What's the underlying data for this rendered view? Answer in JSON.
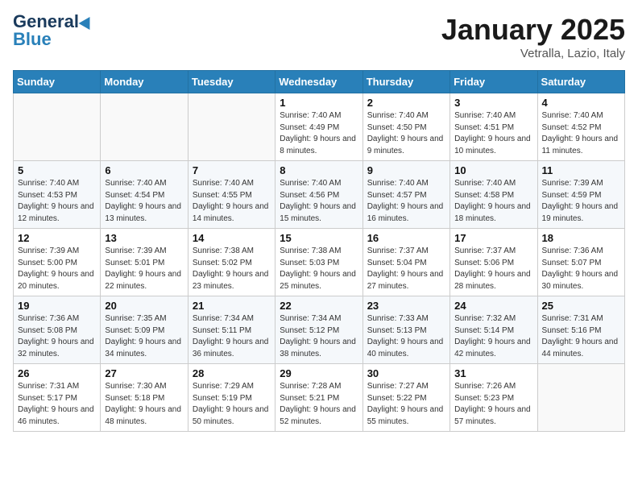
{
  "header": {
    "logo_line1": "General",
    "logo_line2": "Blue",
    "month": "January 2025",
    "location": "Vetralla, Lazio, Italy"
  },
  "days_of_week": [
    "Sunday",
    "Monday",
    "Tuesday",
    "Wednesday",
    "Thursday",
    "Friday",
    "Saturday"
  ],
  "weeks": [
    [
      {
        "day": "",
        "info": ""
      },
      {
        "day": "",
        "info": ""
      },
      {
        "day": "",
        "info": ""
      },
      {
        "day": "1",
        "info": "Sunrise: 7:40 AM\nSunset: 4:49 PM\nDaylight: 9 hours and 8 minutes."
      },
      {
        "day": "2",
        "info": "Sunrise: 7:40 AM\nSunset: 4:50 PM\nDaylight: 9 hours and 9 minutes."
      },
      {
        "day": "3",
        "info": "Sunrise: 7:40 AM\nSunset: 4:51 PM\nDaylight: 9 hours and 10 minutes."
      },
      {
        "day": "4",
        "info": "Sunrise: 7:40 AM\nSunset: 4:52 PM\nDaylight: 9 hours and 11 minutes."
      }
    ],
    [
      {
        "day": "5",
        "info": "Sunrise: 7:40 AM\nSunset: 4:53 PM\nDaylight: 9 hours and 12 minutes."
      },
      {
        "day": "6",
        "info": "Sunrise: 7:40 AM\nSunset: 4:54 PM\nDaylight: 9 hours and 13 minutes."
      },
      {
        "day": "7",
        "info": "Sunrise: 7:40 AM\nSunset: 4:55 PM\nDaylight: 9 hours and 14 minutes."
      },
      {
        "day": "8",
        "info": "Sunrise: 7:40 AM\nSunset: 4:56 PM\nDaylight: 9 hours and 15 minutes."
      },
      {
        "day": "9",
        "info": "Sunrise: 7:40 AM\nSunset: 4:57 PM\nDaylight: 9 hours and 16 minutes."
      },
      {
        "day": "10",
        "info": "Sunrise: 7:40 AM\nSunset: 4:58 PM\nDaylight: 9 hours and 18 minutes."
      },
      {
        "day": "11",
        "info": "Sunrise: 7:39 AM\nSunset: 4:59 PM\nDaylight: 9 hours and 19 minutes."
      }
    ],
    [
      {
        "day": "12",
        "info": "Sunrise: 7:39 AM\nSunset: 5:00 PM\nDaylight: 9 hours and 20 minutes."
      },
      {
        "day": "13",
        "info": "Sunrise: 7:39 AM\nSunset: 5:01 PM\nDaylight: 9 hours and 22 minutes."
      },
      {
        "day": "14",
        "info": "Sunrise: 7:38 AM\nSunset: 5:02 PM\nDaylight: 9 hours and 23 minutes."
      },
      {
        "day": "15",
        "info": "Sunrise: 7:38 AM\nSunset: 5:03 PM\nDaylight: 9 hours and 25 minutes."
      },
      {
        "day": "16",
        "info": "Sunrise: 7:37 AM\nSunset: 5:04 PM\nDaylight: 9 hours and 27 minutes."
      },
      {
        "day": "17",
        "info": "Sunrise: 7:37 AM\nSunset: 5:06 PM\nDaylight: 9 hours and 28 minutes."
      },
      {
        "day": "18",
        "info": "Sunrise: 7:36 AM\nSunset: 5:07 PM\nDaylight: 9 hours and 30 minutes."
      }
    ],
    [
      {
        "day": "19",
        "info": "Sunrise: 7:36 AM\nSunset: 5:08 PM\nDaylight: 9 hours and 32 minutes."
      },
      {
        "day": "20",
        "info": "Sunrise: 7:35 AM\nSunset: 5:09 PM\nDaylight: 9 hours and 34 minutes."
      },
      {
        "day": "21",
        "info": "Sunrise: 7:34 AM\nSunset: 5:11 PM\nDaylight: 9 hours and 36 minutes."
      },
      {
        "day": "22",
        "info": "Sunrise: 7:34 AM\nSunset: 5:12 PM\nDaylight: 9 hours and 38 minutes."
      },
      {
        "day": "23",
        "info": "Sunrise: 7:33 AM\nSunset: 5:13 PM\nDaylight: 9 hours and 40 minutes."
      },
      {
        "day": "24",
        "info": "Sunrise: 7:32 AM\nSunset: 5:14 PM\nDaylight: 9 hours and 42 minutes."
      },
      {
        "day": "25",
        "info": "Sunrise: 7:31 AM\nSunset: 5:16 PM\nDaylight: 9 hours and 44 minutes."
      }
    ],
    [
      {
        "day": "26",
        "info": "Sunrise: 7:31 AM\nSunset: 5:17 PM\nDaylight: 9 hours and 46 minutes."
      },
      {
        "day": "27",
        "info": "Sunrise: 7:30 AM\nSunset: 5:18 PM\nDaylight: 9 hours and 48 minutes."
      },
      {
        "day": "28",
        "info": "Sunrise: 7:29 AM\nSunset: 5:19 PM\nDaylight: 9 hours and 50 minutes."
      },
      {
        "day": "29",
        "info": "Sunrise: 7:28 AM\nSunset: 5:21 PM\nDaylight: 9 hours and 52 minutes."
      },
      {
        "day": "30",
        "info": "Sunrise: 7:27 AM\nSunset: 5:22 PM\nDaylight: 9 hours and 55 minutes."
      },
      {
        "day": "31",
        "info": "Sunrise: 7:26 AM\nSunset: 5:23 PM\nDaylight: 9 hours and 57 minutes."
      },
      {
        "day": "",
        "info": ""
      }
    ]
  ]
}
